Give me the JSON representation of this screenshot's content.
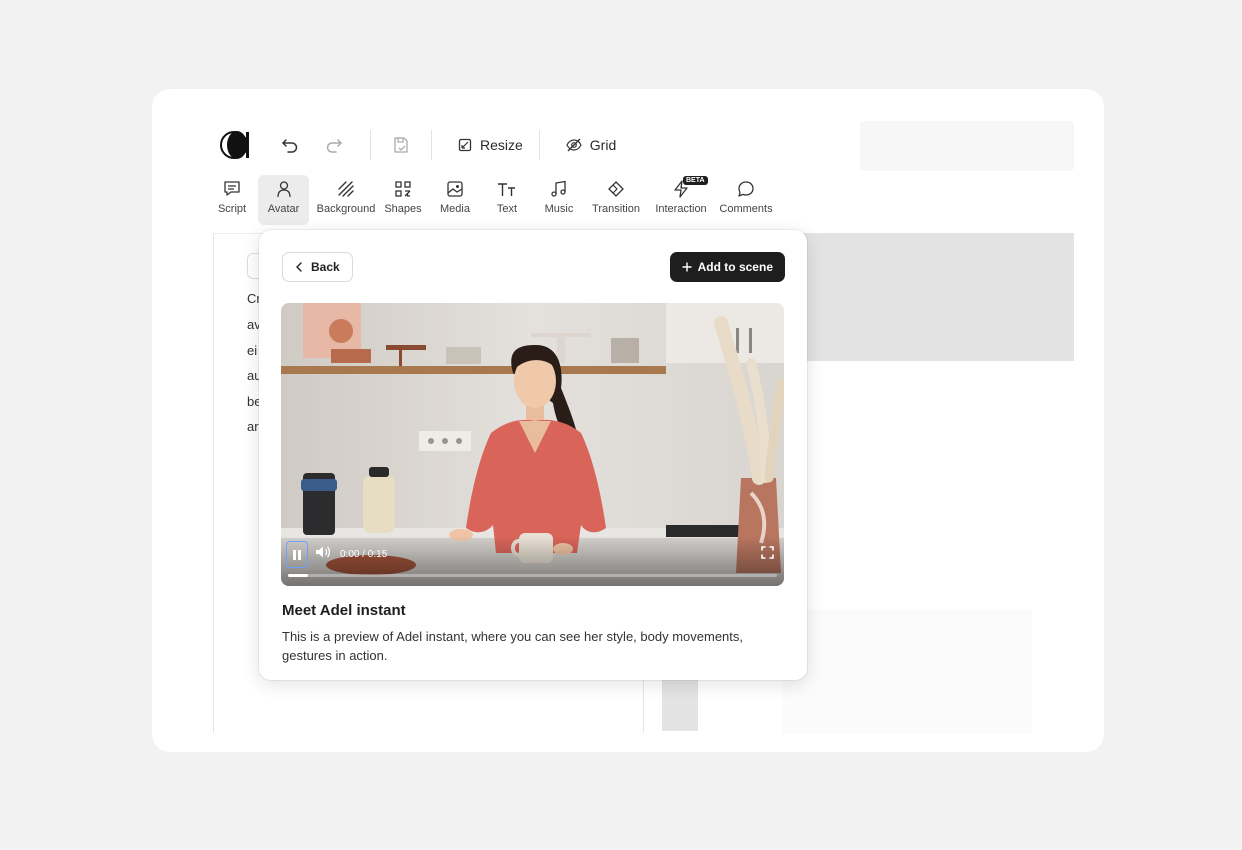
{
  "toolbar": {
    "resize_label": "Resize",
    "grid_label": "Grid"
  },
  "tools": [
    {
      "label": "Script",
      "icon": "script-icon"
    },
    {
      "label": "Avatar",
      "icon": "avatar-icon",
      "active": true
    },
    {
      "label": "Background",
      "icon": "background-icon"
    },
    {
      "label": "Shapes",
      "icon": "shapes-icon"
    },
    {
      "label": "Media",
      "icon": "media-icon"
    },
    {
      "label": "Text",
      "icon": "text-icon"
    },
    {
      "label": "Music",
      "icon": "music-icon"
    },
    {
      "label": "Transition",
      "icon": "transition-icon"
    },
    {
      "label": "Interaction",
      "icon": "interaction-icon",
      "badge": "BETA"
    },
    {
      "label": "Comments",
      "icon": "comments-icon"
    }
  ],
  "script_fragments": [
    "Cr",
    "av",
    "ei",
    "au",
    "be",
    "ar"
  ],
  "popup": {
    "back_label": "Back",
    "add_label": "Add to scene",
    "video": {
      "time": "0:00 / 0:15",
      "progress": 0.04,
      "state": "playing"
    },
    "title": "Meet Adel instant",
    "description": "This is a preview of Adel instant, where you can see her style, body movements, gestures in action."
  },
  "colors": {
    "accent_dark": "#1e1e1e",
    "page_bg": "#f2f2f3",
    "focus_ring": "#6fa0ff"
  }
}
